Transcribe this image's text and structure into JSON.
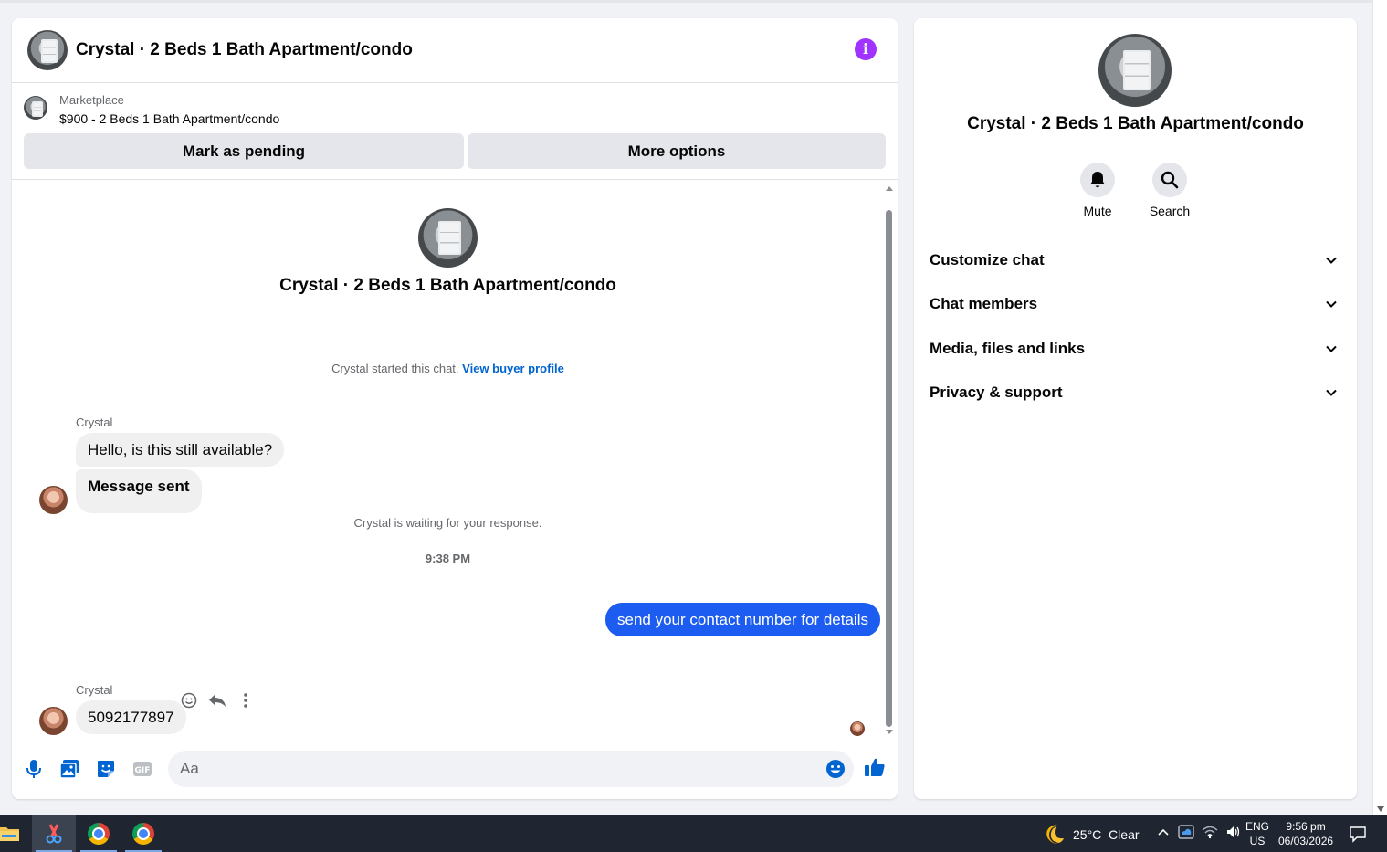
{
  "chat": {
    "title": "Crystal · 2 Beds 1 Bath Apartment/condo",
    "marketplace_label": "Marketplace",
    "listing": "$900 - 2 Beds 1 Bath Apartment/condo",
    "mark_pending": "Mark as pending",
    "more_options": "More options"
  },
  "thread": {
    "intro_title": "Crystal · 2 Beds 1 Bath Apartment/condo",
    "started_text": "Crystal started this chat.",
    "view_buyer_profile": "View buyer profile",
    "waiting_text": "Crystal is waiting for your response.",
    "timestamp": "9:38 PM",
    "group1_sender": "Crystal",
    "msg1": "Hello, is this still available?",
    "msg2": "Message sent",
    "msg3": "send your contact number for details",
    "group2_sender": "Crystal",
    "msg4": "5092177897"
  },
  "composer": {
    "placeholder": "Aa"
  },
  "side": {
    "title": "Crystal · 2 Beds 1 Bath Apartment/condo",
    "mute": "Mute",
    "search": "Search",
    "sections": [
      "Customize chat",
      "Chat members",
      "Media, files and links",
      "Privacy & support"
    ]
  },
  "taskbar": {
    "weather": "25°C  Clear",
    "lang1": "ENG",
    "lang2": "US",
    "time": "9:56 pm",
    "date": "06/03/2026"
  },
  "colors": {
    "accent": "#0064d1",
    "outgoing_bubble": "#1c5cf0",
    "info": "#a033ff"
  }
}
